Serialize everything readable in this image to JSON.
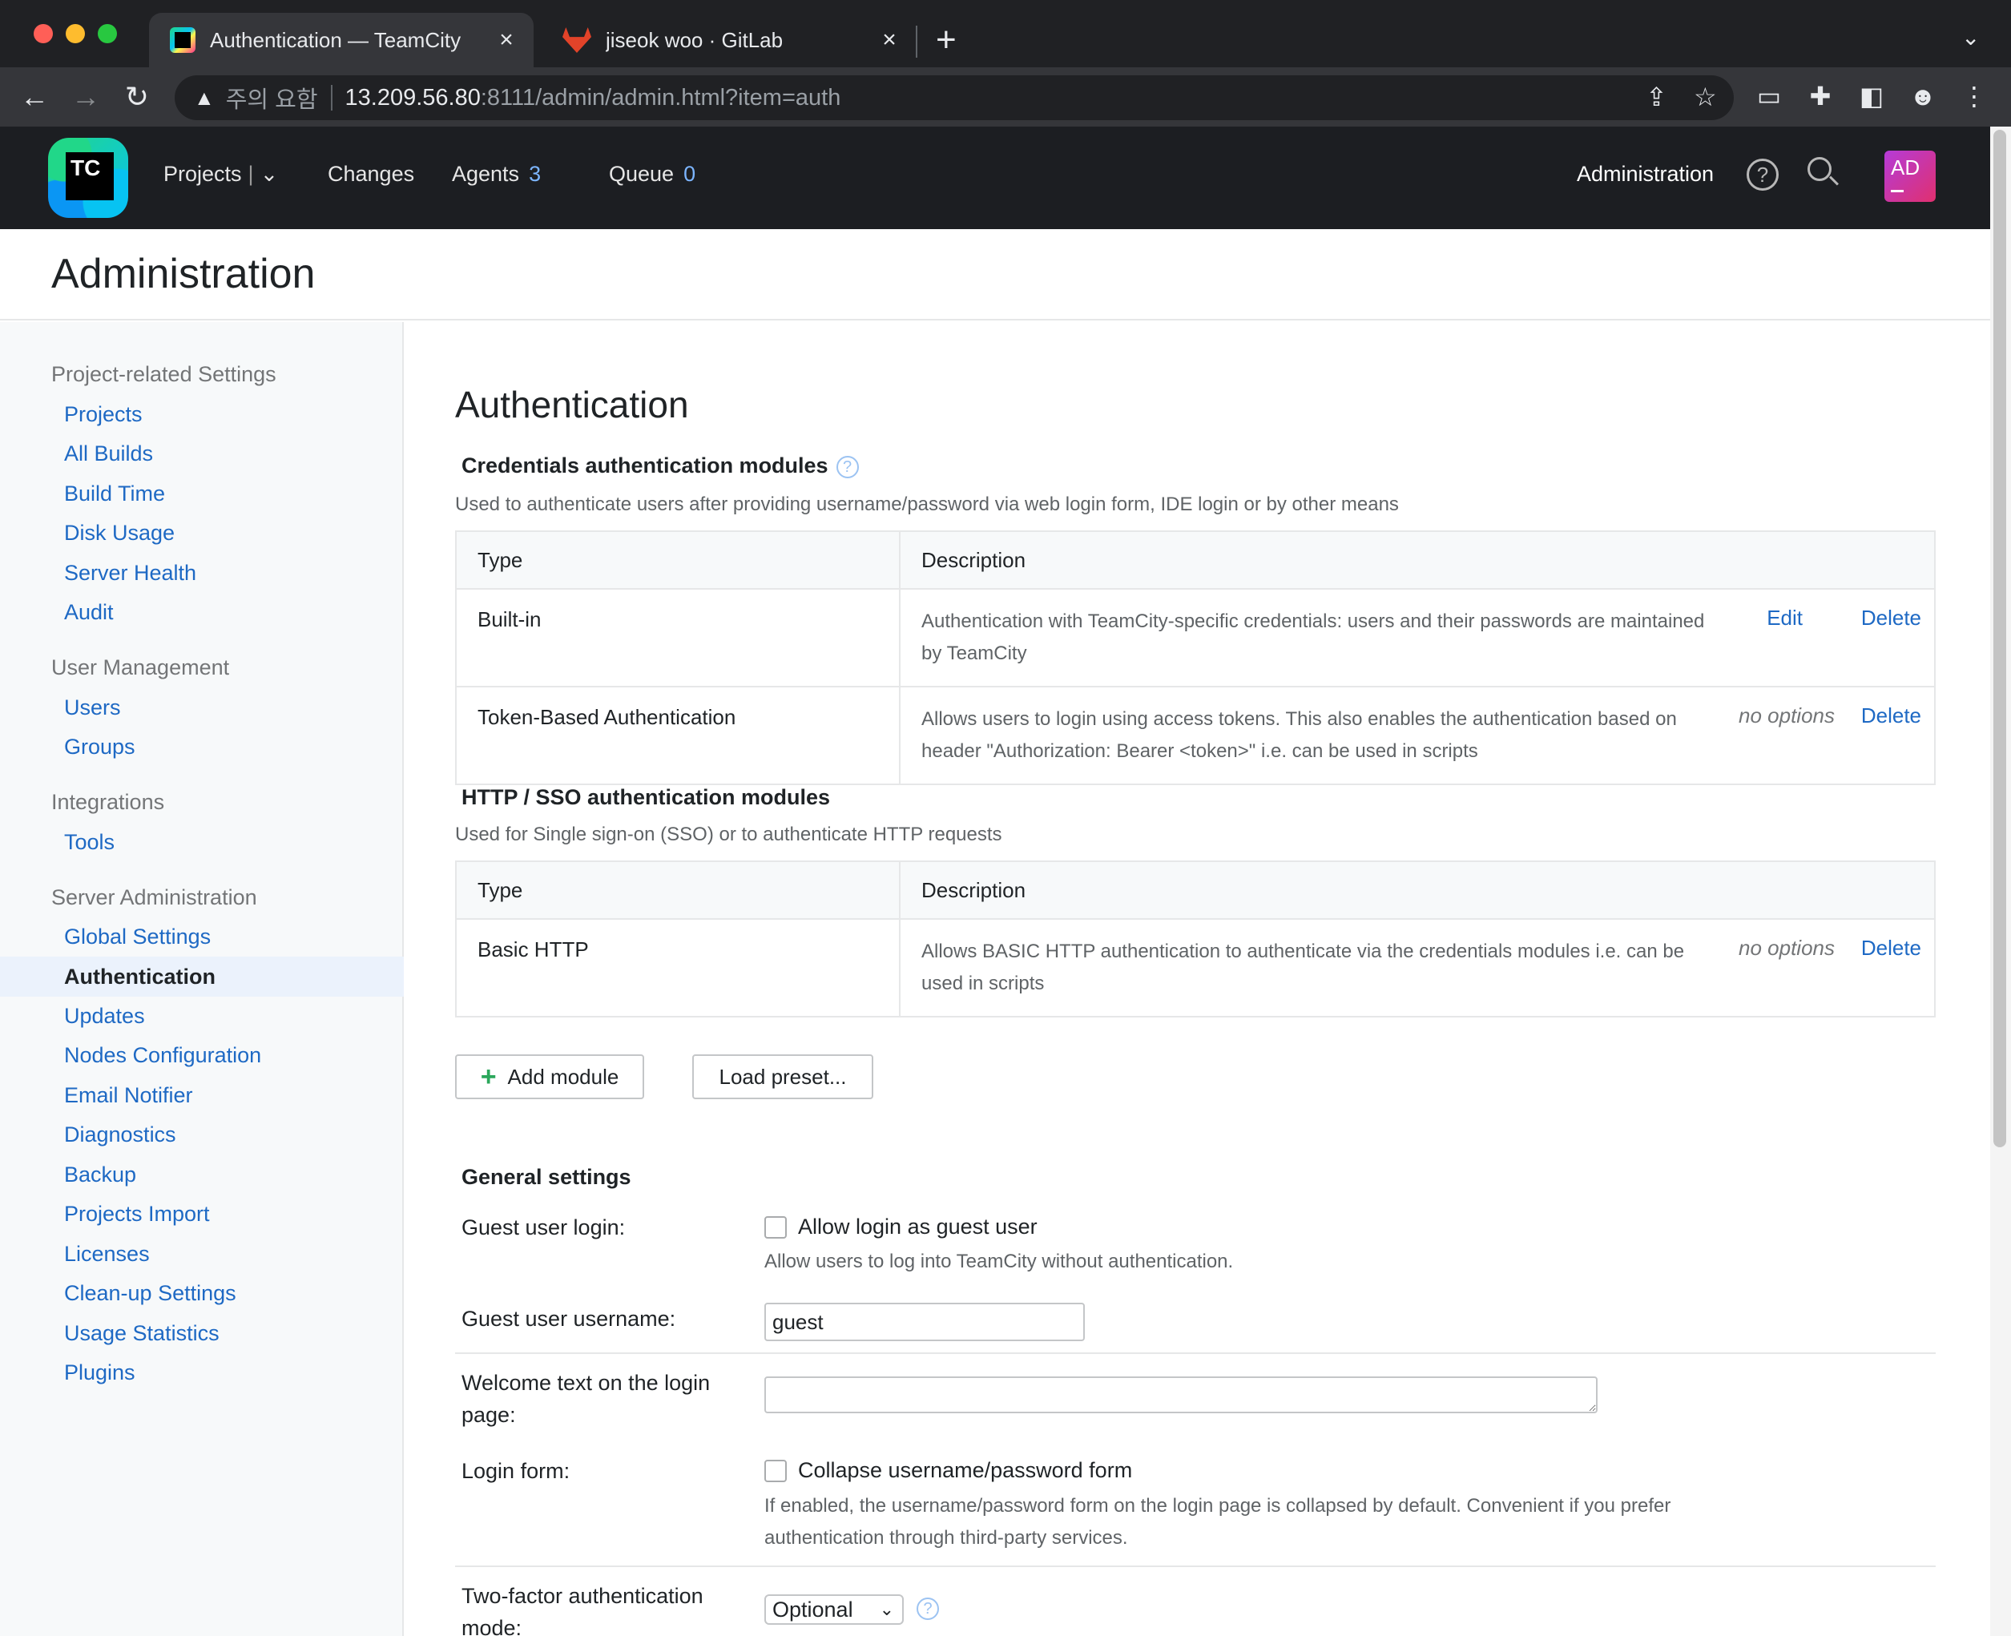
{
  "browser": {
    "tabs": [
      {
        "title": "Authentication — TeamCity",
        "active": true
      },
      {
        "title": "jiseok woo · GitLab",
        "active": false
      }
    ],
    "address": {
      "warning_label": "주의 요함",
      "host": "13.209.56.80",
      "path": ":8111/admin/admin.html?item=auth"
    }
  },
  "header": {
    "logo_text": "TC",
    "nav": {
      "projects": "Projects",
      "changes": "Changes",
      "agents": "Agents",
      "agents_count": "3",
      "queue": "Queue",
      "queue_count": "0"
    },
    "administration": "Administration",
    "help_glyph": "?",
    "avatar": "AD"
  },
  "page": {
    "title": "Administration"
  },
  "sidebar": {
    "sections": [
      {
        "title": "Project-related Settings",
        "items": [
          "Projects",
          "All Builds",
          "Build Time",
          "Disk Usage",
          "Server Health",
          "Audit"
        ]
      },
      {
        "title": "User Management",
        "items": [
          "Users",
          "Groups"
        ]
      },
      {
        "title": "Integrations",
        "items": [
          "Tools"
        ]
      },
      {
        "title": "Server Administration",
        "items": [
          "Global Settings",
          "Authentication",
          "Updates",
          "Nodes Configuration",
          "Email Notifier",
          "Diagnostics",
          "Backup",
          "Projects Import",
          "Licenses",
          "Clean-up Settings",
          "Usage Statistics",
          "Plugins"
        ]
      }
    ],
    "active_item": "Authentication"
  },
  "main": {
    "title": "Authentication",
    "credentials": {
      "title": "Credentials authentication modules",
      "description": "Used to authenticate users after providing username/password via web login form, IDE login or by other means",
      "col_type": "Type",
      "col_description": "Description",
      "rows": [
        {
          "type": "Built-in",
          "description": "Authentication with TeamCity-specific credentials: users and their passwords are maintained by TeamCity",
          "edit": "Edit",
          "delete": "Delete"
        },
        {
          "type": "Token-Based Authentication",
          "description": "Allows users to login using access tokens. This also enables the authentication based on header \"Authorization: Bearer <token>\" i.e. can be used in scripts",
          "no_options": "no options",
          "delete": "Delete"
        }
      ]
    },
    "http_sso": {
      "title": "HTTP / SSO authentication modules",
      "description": "Used for Single sign-on (SSO) or to authenticate HTTP requests",
      "col_type": "Type",
      "col_description": "Description",
      "rows": [
        {
          "type": "Basic HTTP",
          "description": "Allows BASIC HTTP authentication to authenticate via the credentials modules i.e. can be used in scripts",
          "no_options": "no options",
          "delete": "Delete"
        }
      ]
    },
    "buttons": {
      "add_module": "Add module",
      "load_preset": "Load preset..."
    },
    "general": {
      "title": "General settings",
      "guest_login_label": "Guest user login:",
      "guest_login_checkbox": "Allow login as guest user",
      "guest_login_hint": "Allow users to log into TeamCity without authentication.",
      "guest_username_label": "Guest user username:",
      "guest_username_value": "guest",
      "welcome_label": "Welcome text on the login page:",
      "welcome_value": "",
      "login_form_label": "Login form:",
      "login_form_checkbox": "Collapse username/password form",
      "login_form_hint": "If enabled, the username/password form on the login page is collapsed by default. Convenient if you prefer authentication through third-party services.",
      "two_factor_label": "Two-factor authentication mode:",
      "two_factor_value": "Optional"
    }
  },
  "colors": {
    "link": "#1e69c4",
    "header_bg": "#1c1e22",
    "sidebar_bg": "#f7f9fa",
    "active_item_bg": "#ebf2fc"
  }
}
